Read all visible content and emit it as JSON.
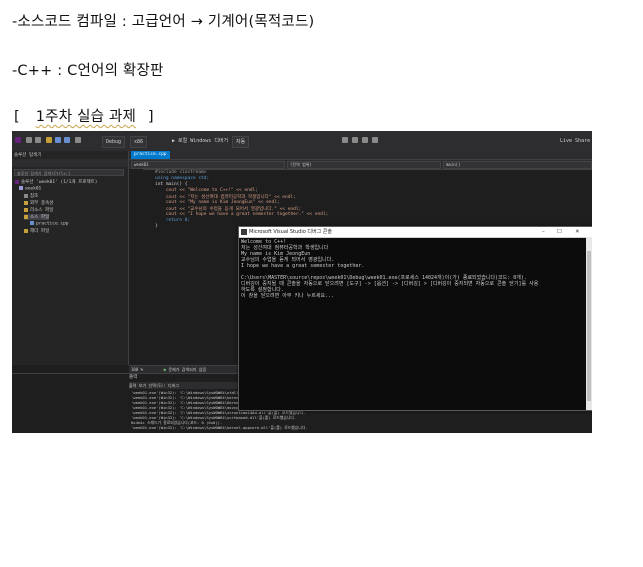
{
  "document": {
    "line1": "-소스코드 컴파일 : 고급언어 → 기계어(목적코드)",
    "line2": "-C++ : C언어의 확장판",
    "heading_open": "[",
    "heading_text": "1주차 실습 과제",
    "heading_close": "]"
  },
  "ide": {
    "config": "Debug",
    "platform": "x86",
    "run_label": "▶ 로컬 Windows 디버거",
    "auto": "자동",
    "live_share": "Live Share",
    "sidebar_title": "솔루션 탐색기",
    "sidebar_search": "솔루션 탐색기 검색(Ctrl+;)",
    "tree": [
      "솔루션 'week01' (1/1개 프로젝트)",
      "week01",
      "참조",
      "외부 종속성",
      "리소스 파일",
      "소스 파일",
      "practice.cpp",
      "헤더 파일"
    ],
    "tab": "practice.cpp",
    "nav_project": "week01",
    "nav_scope": "(전역 범위)",
    "nav_func": "main()",
    "code": [
      "#include <iostream>",
      "using namespace std;",
      "int main() {",
      "    cout << \"Welcome to C++!\" << endl;",
      "    cout << \"저는 성신여대 컴퓨터공학과 학생입니다\" << endl;",
      "    cout << \"My name is Kim JeongEun\" << endl;",
      "    cout << \"교수님의 수업을 듣게 되어서 영광입니다.\" << endl;",
      "    cout << \"I hope we have a great semester together.\" << endl;",
      "    return 0;",
      "}"
    ],
    "zoom": "100 %",
    "status": "문제가 검색되지 않음",
    "output_title": "출력",
    "output_source": "출력 보기 선택(S): 디버그",
    "output_lines": [
      "'week01.exe'(Win32): 'C:\\Windows\\SysWOW64\\ntdll.dll'을(를) 로드했습니다.",
      "'week01.exe'(Win32): 'C:\\Windows\\SysWOW64\\kernel32.dll'을(를) 로드했습니다.",
      "'week01.exe'(Win32): 'C:\\Windows\\SysWOW64\\KernelBase.dll'을(를) 로드했습니다.",
      "'week01.exe'(Win32): 'C:\\Windows\\SysWOW64\\msvcp140d.dll'을(를) 로드했습니다.",
      "'week01.exe'(Win32): 'C:\\Windows\\SysWOW64\\vcruntime140d.dll'을(를) 로드했습니다.",
      "'week01.exe'(Win32): 'C:\\Windows\\SysWOW64\\ucrtbased.dll'을(를) 로드했습니다.",
      "0x4e4c 스레드가 종료되었습니다(코드: 0 (0x0)).",
      "'week01.exe'(Win32): 'C:\\Windows\\SysWOW64\\kernel.appcore.dll'을(를) 로드했습니다."
    ],
    "console_title": "Microsoft Visual Studio 디버그 콘솔",
    "console_lines": [
      "Welcome to C++!",
      "저는 성신여대 컴퓨터공학과 학생입니다",
      "My name is Kim JeongEun",
      "교수님의 수업을 듣게 되어서 영광입니다.",
      "I hope we have a great semester together.",
      "",
      "C:\\Users\\MASTER\\source\\repos\\week01\\Debug\\week01.exe(프로세스 14024개)이(가) 종료되었습니다(코드: 0개).",
      "디버깅이 중지될 때 콘솔을 자동으로 닫으려면 [도구] -> [옵션] -> [디버깅] > [디버깅이 중지되면 자동으로 콘솔 닫기]를 사용",
      "하도록 설정합니다.",
      "이 창을 닫으려면 아무 키나 누르세요..."
    ],
    "console_buttons": [
      "–",
      "☐",
      "✕"
    ]
  }
}
